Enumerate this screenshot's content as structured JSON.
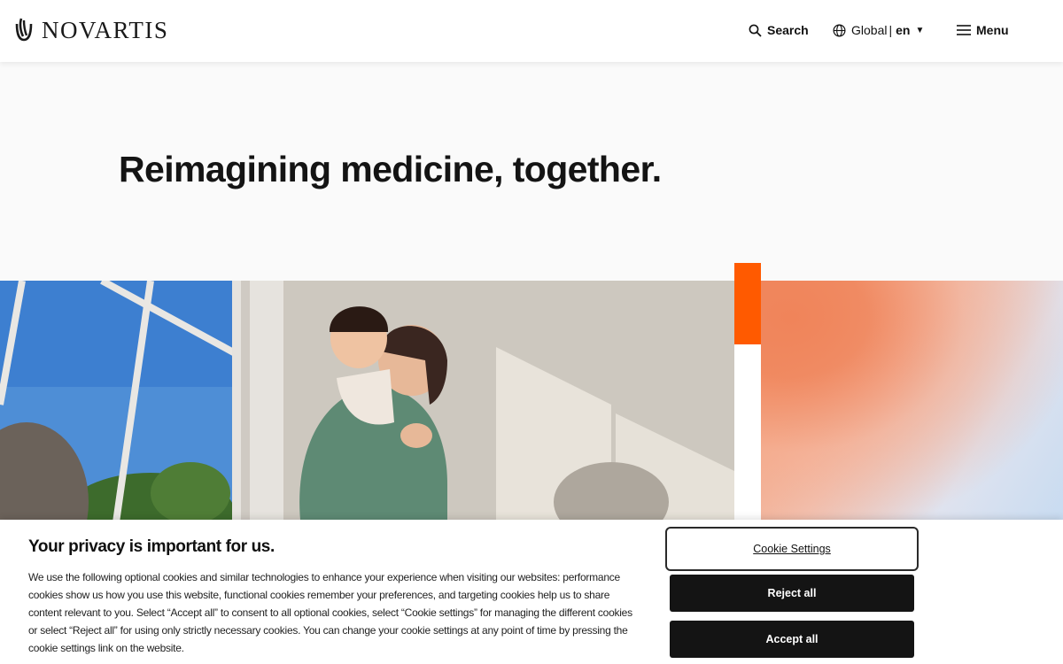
{
  "header": {
    "logo_text": "NOVARTIS",
    "search_label": "Search",
    "region_label": "Global",
    "language_code": "en",
    "menu_label": "Menu"
  },
  "hero": {
    "title_regular": "Reimagining medicine, ",
    "title_bold": "together",
    "title_end": "."
  },
  "cookie_banner": {
    "title": "Your privacy is important for us.",
    "body": "We use the following optional cookies and similar technologies to enhance your experience when visiting our websites: performance cookies show us how you use this website, functional cookies remember your preferences, and targeting cookies help us to share content relevant to you. Select “Accept all” to consent to all optional cookies, select “Cookie settings” for managing the different cookies or select “Reject all” for using only strictly necessary cookies. You can change your cookie settings at any point of time by pressing the cookie settings link on the website.",
    "settings_label": "Cookie Settings",
    "reject_label": "Reject all",
    "accept_label": "Accept all"
  },
  "colors": {
    "accent_orange": "#ff5a00",
    "button_dark": "#141414"
  },
  "icons": {
    "logo": "novartis-flame-icon",
    "search": "search-icon",
    "globe": "globe-icon",
    "caret": "caret-down-icon",
    "menu": "hamburger-menu-icon"
  }
}
